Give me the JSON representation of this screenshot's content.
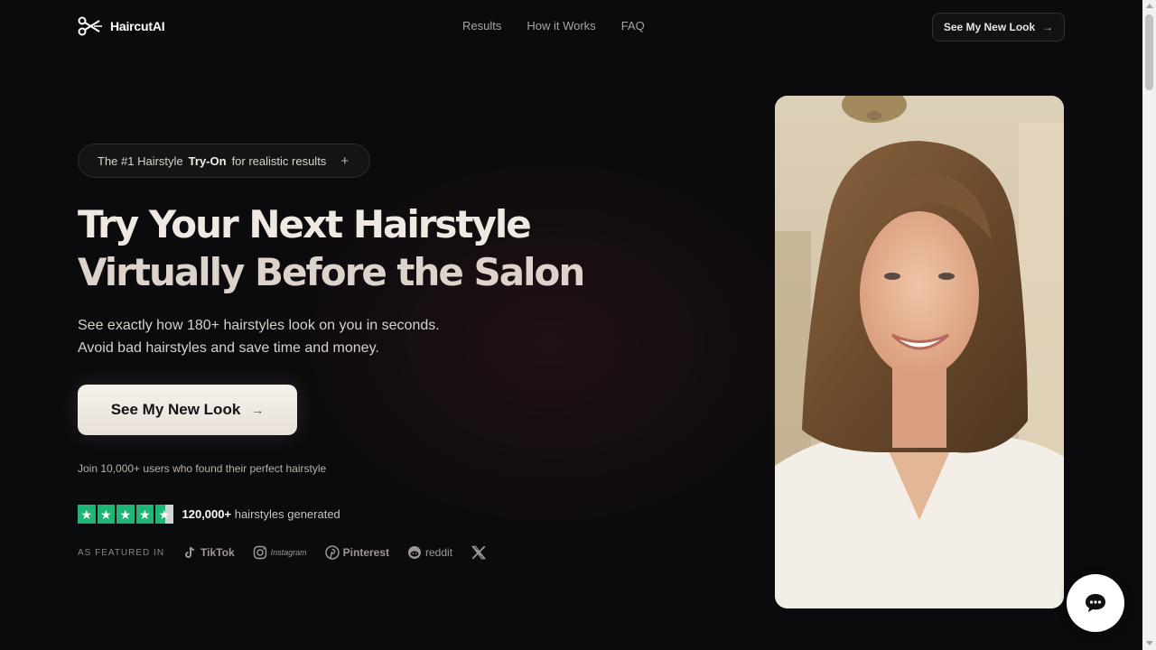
{
  "nav": {
    "logo_text": "HaircutAI",
    "links": [
      "Results",
      "How it Works",
      "FAQ"
    ],
    "cta_label": "See My New Look",
    "cta_arrow": "→"
  },
  "hero": {
    "badge_prefix": "The #1 Hairstyle",
    "badge_highlight": "Try-On",
    "badge_suffix": "for realistic results",
    "badge_plus": "+",
    "headline_line1": "Try Your Next Hairstyle",
    "headline_line2": "Virtually Before the Salon",
    "sub_line1": "See exactly how 180+ hairstyles look on you in seconds.",
    "sub_line2": "Avoid bad hairstyles and save time and money.",
    "cta_label": "See My New Look",
    "cta_arrow": "→",
    "join_text": "Join 10,000+ users who found their perfect hairstyle",
    "rating": {
      "stars": 4.5,
      "count": "120,000+",
      "suffix": "hairstyles generated",
      "star_color": "#1fb574"
    },
    "featured_label": "AS FEATURED IN",
    "brands": [
      {
        "name": "TikTok",
        "icon": "tiktok-icon"
      },
      {
        "name": "Instagram",
        "icon": "instagram-icon"
      },
      {
        "name": "Pinterest",
        "icon": "pinterest-icon"
      },
      {
        "name": "reddit",
        "icon": "reddit-icon"
      },
      {
        "name": "",
        "icon": "x-icon"
      }
    ]
  },
  "colors": {
    "background": "#0b0a0c",
    "cta_background": "#f3ede6",
    "accent_green": "#1fb574"
  }
}
